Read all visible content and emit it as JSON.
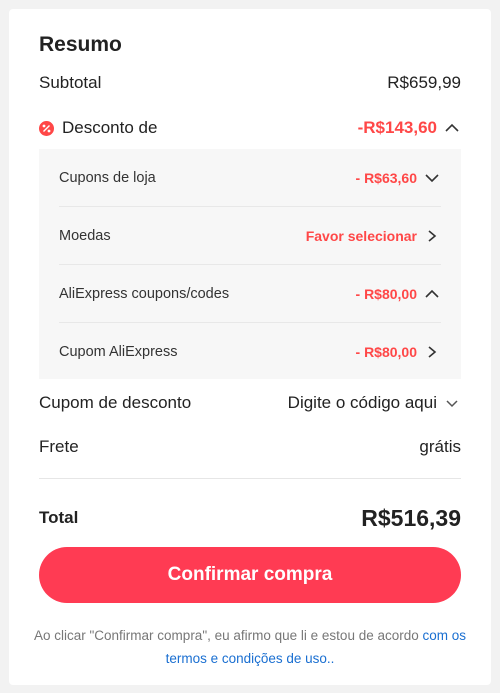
{
  "summary": {
    "title": "Resumo",
    "subtotal_label": "Subtotal",
    "subtotal_value": "R$659,99",
    "discount_label": "Desconto de",
    "discount_value": "-R$143,60",
    "discount_items": [
      {
        "label": "Cupons de loja",
        "value": "- R$63,60",
        "chevron": "chevron-down"
      },
      {
        "label": "Moedas",
        "value": "Favor selecionar",
        "chevron": "chevron-right"
      },
      {
        "label": "AliExpress coupons/codes",
        "value": "- R$80,00",
        "chevron": "chevron-up"
      },
      {
        "label": "Cupom AliExpress",
        "value": "- R$80,00",
        "chevron": "chevron-right"
      }
    ],
    "coupon_label": "Cupom de desconto",
    "coupon_value": "Digite o código aqui",
    "shipping_label": "Frete",
    "shipping_value": "grátis",
    "total_label": "Total",
    "total_value": "R$516,39"
  },
  "confirm_button": "Confirmar compra",
  "terms": {
    "text": "Ao clicar \"Confirmar compra\", eu afirmo que li e estou de acordo ",
    "link": "com os termos e condições de uso",
    "suffix": ".."
  },
  "colors": {
    "accent": "#ff3b53",
    "discount": "#ff4747",
    "link": "#1a6fd1"
  }
}
